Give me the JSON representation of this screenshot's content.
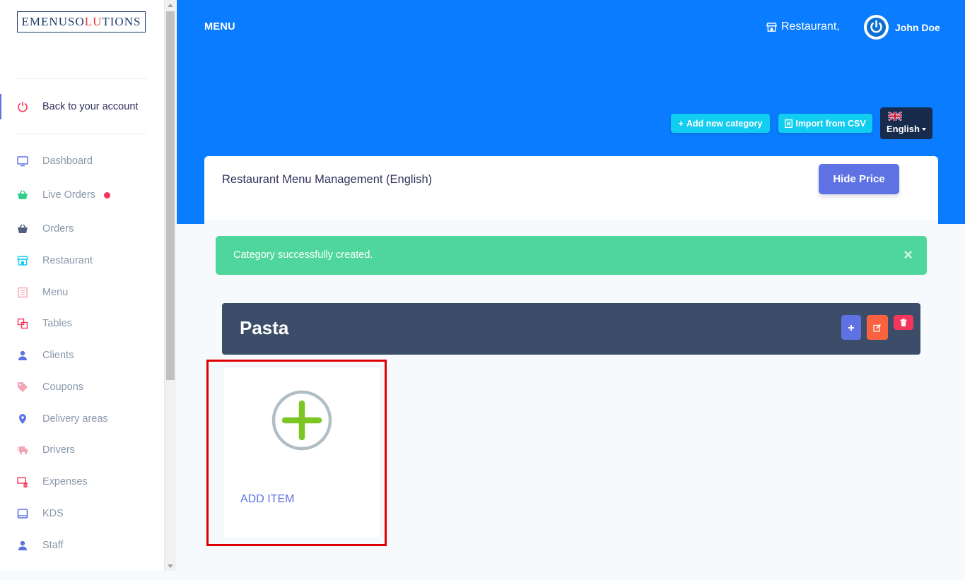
{
  "sidebar": {
    "logo": {
      "part1": "EMENUSO",
      "accent": "LU",
      "part2": "TIONS"
    },
    "back_label": "Back to your account",
    "items": [
      {
        "label": "Dashboard",
        "icon": "monitor-icon"
      },
      {
        "label": "Live Orders",
        "icon": "basket-icon"
      },
      {
        "label": "Orders",
        "icon": "basket-icon"
      },
      {
        "label": "Restaurant",
        "icon": "shop-icon"
      },
      {
        "label": "Menu",
        "icon": "menu-book-icon"
      },
      {
        "label": "Tables",
        "icon": "tables-icon"
      },
      {
        "label": "Clients",
        "icon": "user-icon"
      },
      {
        "label": "Coupons",
        "icon": "tag-icon"
      },
      {
        "label": "Delivery areas",
        "icon": "pin-icon"
      },
      {
        "label": "Drivers",
        "icon": "delivery-icon"
      },
      {
        "label": "Expenses",
        "icon": "expenses-icon"
      },
      {
        "label": "KDS",
        "icon": "tablet-icon"
      },
      {
        "label": "Staff",
        "icon": "user-icon"
      }
    ]
  },
  "header": {
    "title": "MENU",
    "restaurant": "Restaurant,",
    "user_name": "John Doe",
    "add_category_label": "Add new category",
    "import_csv_label": "Import from CSV",
    "language": "English"
  },
  "card": {
    "title": "Restaurant Menu Management (English)",
    "hide_price_label": "Hide Price"
  },
  "alert": {
    "message": "Category successfully created.",
    "close_symbol": "×"
  },
  "category": {
    "name": "Pasta"
  },
  "add_item": {
    "label": "ADD ITEM"
  },
  "colors": {
    "primary": "#5e72e4",
    "header_blue": "#0a7cff",
    "info": "#11cdef",
    "success": "#4fd69c",
    "danger": "#f5365c",
    "warning": "#fb6340",
    "category_bg": "#3c4d69"
  }
}
